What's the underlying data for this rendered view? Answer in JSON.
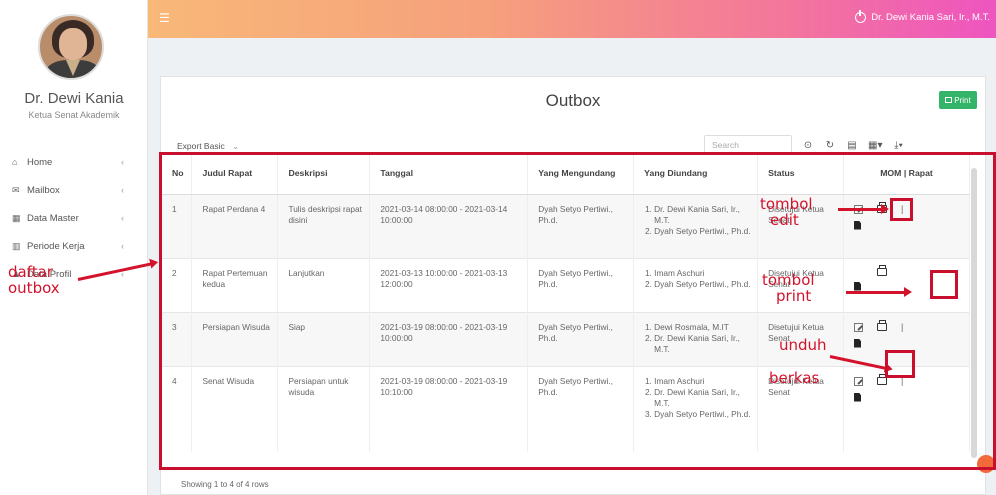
{
  "sidebar": {
    "user_name": "Dr. Dewi Kania",
    "user_role": "Ketua Senat Akademik",
    "items": [
      {
        "label": "Home",
        "icon": "home-icon"
      },
      {
        "label": "Mailbox",
        "icon": "envelope-icon"
      },
      {
        "label": "Data Master",
        "icon": "grid-icon"
      },
      {
        "label": "Periode Kerja",
        "icon": "bar-chart-icon"
      },
      {
        "label": "Data Profil",
        "icon": "user-icon"
      }
    ]
  },
  "topbar": {
    "menu_icon": "hamburger-icon",
    "user_label": "Dr. Dewi Kania Sari, Ir., M.T."
  },
  "panel": {
    "title": "Outbox",
    "print_label": "Print",
    "export_label": "Export Basic",
    "search_placeholder": "Search",
    "footer": "Showing 1 to 4 of 4 rows"
  },
  "table": {
    "headers": [
      "No",
      "Judul Rapat",
      "Deskripsi",
      "Tanggal",
      "Yang Mengundang",
      "Yang Diundang",
      "Status",
      "MOM | Rapat"
    ],
    "rows": [
      {
        "no": "1",
        "judul": "Rapat Perdana 4",
        "deskripsi": "Tulis deskripsi rapat disini",
        "tanggal": "2021-03-14 08:00:00 - 2021-03-14 10:00:00",
        "pengundang": "Dyah Setyo Pertiwi., Ph.d.",
        "diundang": [
          "Dr. Dewi Kania Sari, Ir., M.T.",
          "Dyah Setyo Pertiwi., Ph.d."
        ],
        "status": "Disetujui Ketua Senat"
      },
      {
        "no": "2",
        "judul": "Rapat Pertemuan kedua",
        "deskripsi": "Lanjutkan",
        "tanggal": "2021-03-13 10:00:00 - 2021-03-13 12:00:00",
        "pengundang": "Dyah Setyo Pertiwi., Ph.d.",
        "diundang": [
          "Imam Aschuri",
          "Dyah Setyo Pertiwi., Ph.d."
        ],
        "status": "Disetujui Ketua Senat"
      },
      {
        "no": "3",
        "judul": "Persiapan Wisuda",
        "deskripsi": "Siap",
        "tanggal": "2021-03-19 08:00:00 - 2021-03-19 10:00:00",
        "pengundang": "Dyah Setyo Pertiwi., Ph.d.",
        "diundang": [
          "Dewi Rosmala, M.IT",
          "Dr. Dewi Kania Sari, Ir., M.T."
        ],
        "status": "Disetujui Ketua Senat"
      },
      {
        "no": "4",
        "judul": "Senat Wisuda",
        "deskripsi": "Persiapan untuk wisuda",
        "tanggal": "2021-03-19 08:00:00 - 2021-03-19 10:10:00",
        "pengundang": "Dyah Setyo Pertiwi., Ph.d.",
        "diundang": [
          "Imam Aschuri",
          "Dr. Dewi Kania Sari, Ir., M.T.",
          "Dyah Setyo Pertiwi., Ph.d."
        ],
        "status": "Disetujui Ketua Senat"
      }
    ]
  },
  "annotations": {
    "daftar_outbox": [
      "daftar",
      "outbox"
    ],
    "tombol_edit": [
      "tombol",
      "edit"
    ],
    "tombol_print": [
      "tombol",
      "print"
    ],
    "unduh_berkas": [
      "unduh",
      "berkas"
    ],
    "color": "#d3122b"
  },
  "colors": {
    "topbar_start": "#f8b878",
    "topbar_end": "#ee55c0",
    "print_button": "#34b468"
  }
}
